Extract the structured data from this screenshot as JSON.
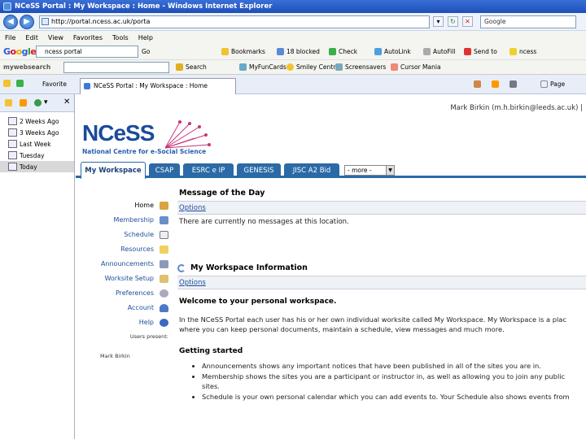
{
  "window": {
    "title": "NCeSS Portal : My Workspace : Home - Windows Internet Explorer"
  },
  "browser": {
    "address": "http://portal.ncess.ac.uk/porta",
    "search_placeholder": "Google",
    "menu": [
      "File",
      "Edit",
      "View",
      "Favorites",
      "Tools",
      "Help"
    ],
    "google_query": "ncess portal",
    "google_go": "Go",
    "toolbar_items": [
      "Bookmarks",
      "18 blocked",
      "Check",
      "AutoLink",
      "AutoFill",
      "Send to",
      "ncess"
    ],
    "mywebsearch_label": "mywebsearch",
    "toolbar2_items": [
      "Search",
      "MyFunCards",
      "Smiley Central",
      "Screensavers",
      "Cursor Mania"
    ],
    "favorites_label": "Favorite",
    "tab_title": "NCeSS Portal : My Workspace : Home",
    "page_menu": "Page"
  },
  "history": [
    "2 Weeks Ago",
    "3 Weeks Ago",
    "Last Week",
    "Tuesday",
    "Today"
  ],
  "portal": {
    "user_line": "Mark Birkin (m.h.birkin@leeds.ac.uk)  |",
    "logo_main": "NCeSS",
    "logo_sub": "National Centre for e-Social Science",
    "site_tabs": [
      "My Workspace",
      "CSAP",
      "ESRC e IP",
      "GENESIS",
      "JISC A2 Bid"
    ],
    "more_label": "- more -",
    "nav": [
      "Home",
      "Membership",
      "Schedule",
      "Resources",
      "Announcements",
      "Worksite Setup",
      "Preferences",
      "Account",
      "Help"
    ],
    "users_present_label": "Users present:",
    "user_present": "Mark Birkin",
    "motd": {
      "title": "Message of the Day",
      "options": "Options",
      "message": "There are currently no messages at this location."
    },
    "ws_info": {
      "title": "My Workspace Information",
      "options": "Options",
      "welcome": "Welcome to your personal workspace.",
      "intro_line1": "In the NCeSS Portal each user has his or her own individual worksite called My Workspace. My Workspace is a plac",
      "intro_line2": "where you can keep personal documents, maintain a schedule, view messages and much more.",
      "getting_started": "Getting started",
      "bullets": [
        "Announcements shows any important notices that have been published in all of the sites you are in.",
        "Membership shows the sites you are a participant or instructor in, as well as allowing you to join any public",
        "sites.",
        "Schedule is your own personal calendar which you can add events to. Your Schedule also shows events from"
      ]
    }
  }
}
